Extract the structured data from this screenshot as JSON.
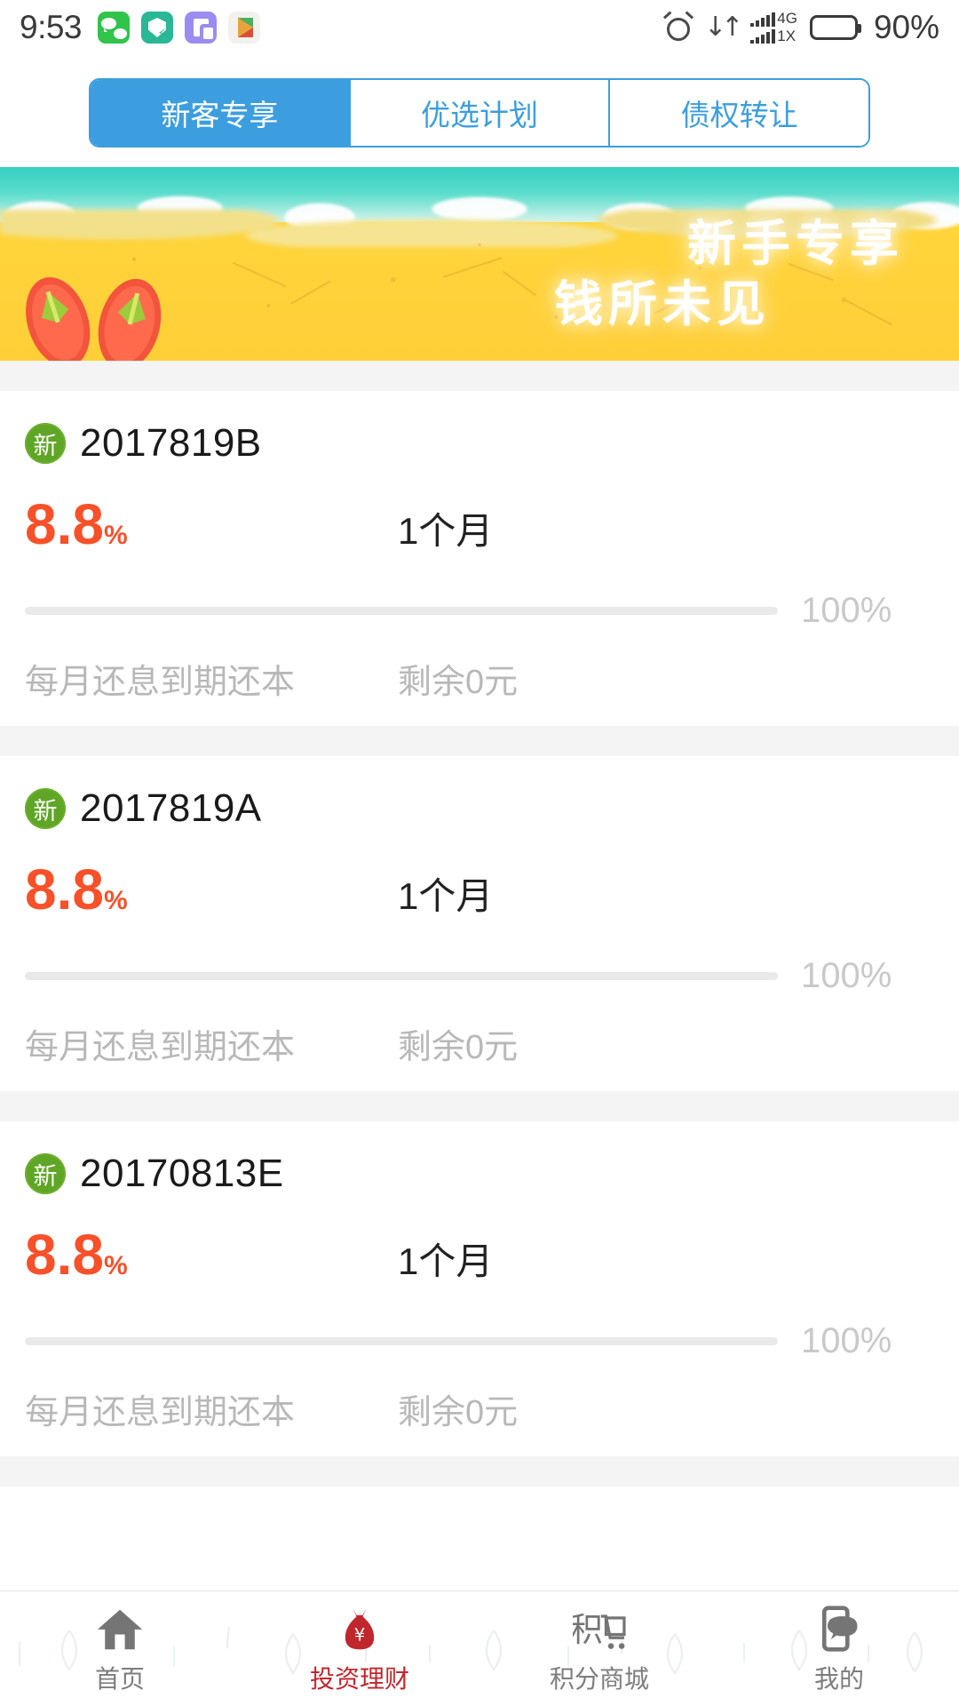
{
  "statusbar": {
    "time": "9:53",
    "battery_percent": "90%",
    "network_main": "4G",
    "network_sub": "1X",
    "app_icons": [
      "wechat-icon",
      "security-shield-icon",
      "purple-app-icon",
      "google-play-icon"
    ],
    "status_icons": [
      "alarm-icon",
      "data-transfer-icon",
      "signal-icon",
      "battery-icon"
    ]
  },
  "tabs": [
    {
      "label": "新客专享",
      "active": true
    },
    {
      "label": "优选计划",
      "active": false
    },
    {
      "label": "债权转让",
      "active": false
    }
  ],
  "banner": {
    "headline": "新手专享",
    "subline": "钱所未见",
    "scene": "beach-sea-sand-flipflops",
    "sand_color": "#ffd93b",
    "sea_color": "#36d0c0"
  },
  "products": [
    {
      "badge": "新",
      "title": "2017819B",
      "rate": "8.8",
      "rate_unit": "%",
      "term": "1个月",
      "progress": 100,
      "progress_label": "100%",
      "repayment": "每月还息到期还本",
      "remaining": "剩余0元"
    },
    {
      "badge": "新",
      "title": "2017819A",
      "rate": "8.8",
      "rate_unit": "%",
      "term": "1个月",
      "progress": 100,
      "progress_label": "100%",
      "repayment": "每月还息到期还本",
      "remaining": "剩余0元"
    },
    {
      "badge": "新",
      "title": "20170813E",
      "rate": "8.8",
      "rate_unit": "%",
      "term": "1个月",
      "progress": 100,
      "progress_label": "100%",
      "repayment": "每月还息到期还本",
      "remaining": "剩余0元"
    }
  ],
  "bottom_nav": [
    {
      "label": "首页",
      "icon": "home-icon",
      "active": false
    },
    {
      "label": "投资理财",
      "icon": "money-bag-icon",
      "active": true
    },
    {
      "label": "积分商城",
      "icon": "points-mall-cart-icon",
      "active": false
    },
    {
      "label": "我的",
      "icon": "profile-phone-icon",
      "active": false
    }
  ],
  "colors": {
    "accent_blue": "#3c9ede",
    "rate_orange": "#f7512a",
    "active_red": "#c0272d",
    "badge_green": "#5fa626"
  }
}
